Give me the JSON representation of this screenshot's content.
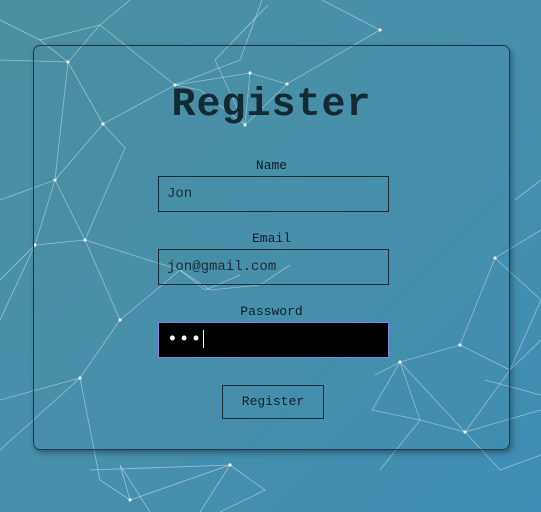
{
  "form": {
    "title": "Register",
    "name": {
      "label": "Name",
      "value": "Jon"
    },
    "email": {
      "label": "Email",
      "value": "jon@gmail.com"
    },
    "password": {
      "label": "Password",
      "masked_value": "•••",
      "focused": true
    },
    "submit_label": "Register"
  },
  "colors": {
    "background": "#4790ab",
    "card_border": "#1f3a44",
    "text": "#132a32",
    "focused_field_bg": "#000000",
    "focused_field_border": "#7a86e0"
  }
}
